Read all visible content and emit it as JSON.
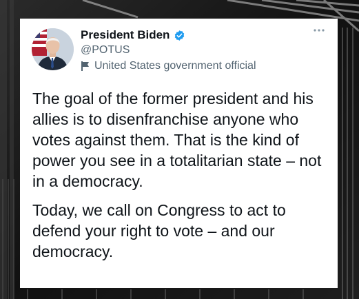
{
  "tweet": {
    "author_name": "President Biden",
    "handle": "@POTUS",
    "account_label": "United States government official",
    "paragraphs": [
      "The goal of the former president and his allies is to disenfranchise anyone who votes against them. That is the kind of power you see in a totalitarian state – not in a democracy.",
      "Today, we call on Congress to act to defend your right to vote – and our democracy."
    ]
  },
  "icons": {
    "verified": "verified-badge-icon",
    "label": "flag-icon",
    "more": "more-options-icon"
  },
  "colors": {
    "verified_blue": "#1d9bf0",
    "text_primary": "#0f1419",
    "text_secondary": "#536471",
    "card_bg": "#ffffff",
    "page_bg": "#0d0d0d"
  }
}
